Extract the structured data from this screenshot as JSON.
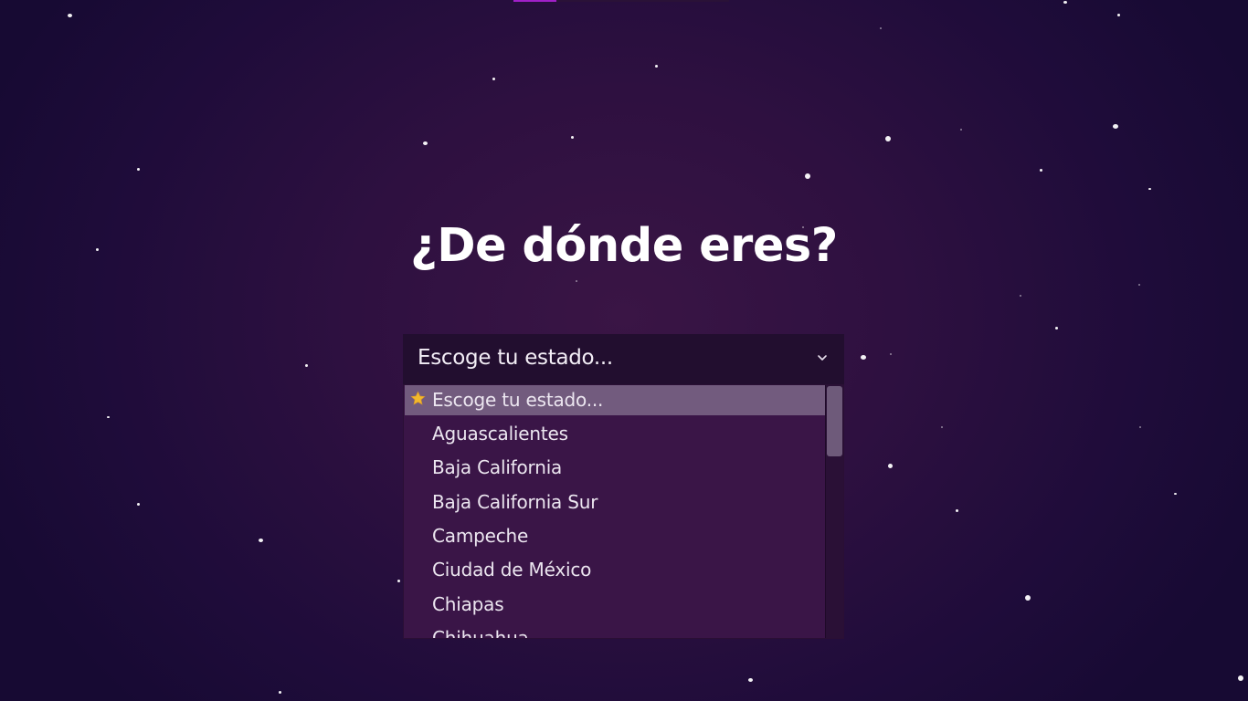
{
  "progress": {
    "fraction": 0.2
  },
  "page": {
    "title": "¿De dónde eres?"
  },
  "state_select": {
    "value": "Escoge tu estado...",
    "chevron_icon": "chevron-down-icon",
    "options": [
      {
        "label": "Escoge tu estado...",
        "icon": "star-icon",
        "selected": true
      },
      {
        "label": "Aguascalientes"
      },
      {
        "label": "Baja California"
      },
      {
        "label": "Baja California Sur"
      },
      {
        "label": "Campeche"
      },
      {
        "label": "Ciudad de México"
      },
      {
        "label": "Chiapas"
      },
      {
        "label": "Chihuahua"
      }
    ]
  },
  "colors": {
    "accent": "#a020c8",
    "background": "#2e1040",
    "selected_option": "#725b7e",
    "star": "#f2b92c"
  }
}
